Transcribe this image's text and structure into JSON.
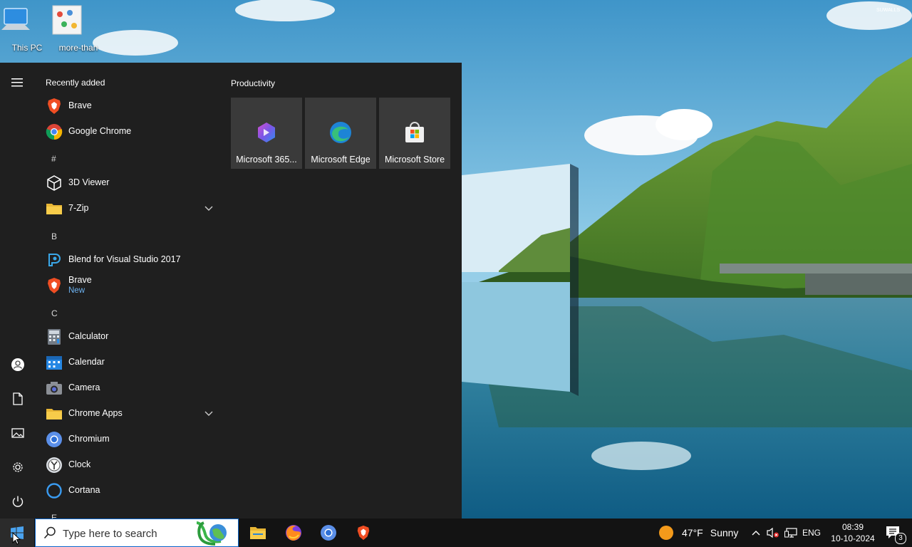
{
  "desktop": {
    "icons": [
      {
        "label": "This PC"
      },
      {
        "label": "more-than"
      }
    ],
    "watermark": "SUWALLS"
  },
  "start_menu": {
    "recently_added_header": "Recently added",
    "recent": [
      {
        "label": "Brave",
        "icon": "brave-icon"
      },
      {
        "label": "Google Chrome",
        "icon": "chrome-icon"
      }
    ],
    "letters": {
      "hash": "#",
      "b": "B",
      "c": "C",
      "e": "E"
    },
    "apps": [
      {
        "label": "3D Viewer",
        "icon": "cube-icon"
      },
      {
        "label": "7-Zip",
        "icon": "folder-icon"
      },
      {
        "label": "Blend for Visual Studio 2017",
        "icon": "blend-icon"
      },
      {
        "label": "Brave",
        "sub": "New",
        "icon": "brave-icon"
      },
      {
        "label": "Calculator",
        "icon": "calculator-icon"
      },
      {
        "label": "Calendar",
        "icon": "calendar-icon"
      },
      {
        "label": "Camera",
        "icon": "camera-icon"
      },
      {
        "label": "Chrome Apps",
        "icon": "folder-icon"
      },
      {
        "label": "Chromium",
        "icon": "chromium-icon"
      },
      {
        "label": "Clock",
        "icon": "clock-icon"
      },
      {
        "label": "Cortana",
        "icon": "cortana-icon"
      }
    ],
    "tiles_header": "Productivity",
    "tiles": [
      {
        "label": "Microsoft 365...",
        "icon": "m365-icon"
      },
      {
        "label": "Microsoft Edge",
        "icon": "edge-icon"
      },
      {
        "label": "Microsoft Store",
        "icon": "store-icon"
      }
    ],
    "rail_icons": [
      "hamburger-icon",
      "user-icon",
      "document-icon",
      "pictures-icon",
      "gear-icon",
      "power-icon"
    ]
  },
  "taskbar": {
    "search_placeholder": "Type here to search",
    "pinned": [
      "file-explorer-icon",
      "firefox-icon",
      "chromium-icon",
      "brave-icon"
    ],
    "weather": {
      "temp": "47°F",
      "condition": "Sunny"
    },
    "language": "ENG",
    "time": "08:39",
    "date": "10-10-2024",
    "notifications_count": "3"
  },
  "colors": {
    "menu_bg": "#1f1f1f",
    "tile_bg": "#3a3a3a",
    "taskbar_bg": "#131313",
    "accent_blue": "#0a63c9",
    "new_badge": "#6db3f2"
  }
}
